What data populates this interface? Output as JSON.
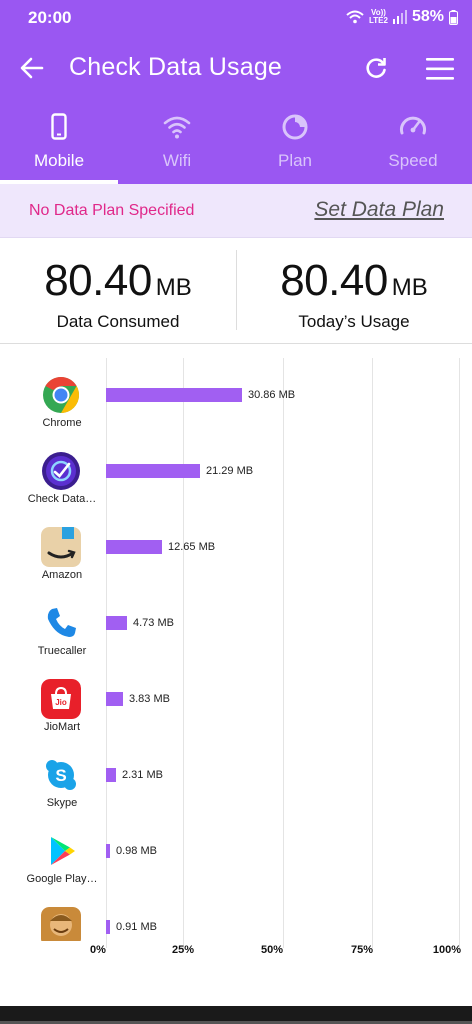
{
  "status": {
    "time": "20:00",
    "net_line1": "Vo))",
    "net_line2": "LTE2",
    "battery": "58%"
  },
  "header": {
    "title": "Check Data Usage"
  },
  "tabs": [
    {
      "label": "Mobile",
      "icon": "phone-icon",
      "active": true
    },
    {
      "label": "Wifi",
      "icon": "wifi-icon",
      "active": false
    },
    {
      "label": "Plan",
      "icon": "plan-icon",
      "active": false
    },
    {
      "label": "Speed",
      "icon": "speedometer-icon",
      "active": false
    }
  ],
  "plan": {
    "status": "No Data Plan Specified",
    "action": "Set Data Plan"
  },
  "totals": {
    "consumed_value": "80.40",
    "consumed_unit": "MB",
    "consumed_label": "Data Consumed",
    "today_value": "80.40",
    "today_unit": "MB",
    "today_label": "Today’s Usage"
  },
  "chart_data": {
    "type": "bar",
    "orientation": "horizontal",
    "categories": [
      "Chrome",
      "Check Data…",
      "Amazon",
      "Truecaller",
      "JioMart",
      "Skype",
      "Google Play…",
      ""
    ],
    "values_mb": [
      30.86,
      21.29,
      12.65,
      4.73,
      3.83,
      2.31,
      0.98,
      0.91
    ],
    "value_labels": [
      "30.86 MB",
      "21.29 MB",
      "12.65 MB",
      "4.73 MB",
      "3.83 MB",
      "2.31 MB",
      "0.98 MB",
      "0.91 MB"
    ],
    "x_ticks": [
      "0%",
      "25%",
      "50%",
      "75%",
      "100%"
    ],
    "xlim_percent": [
      0,
      100
    ],
    "total_mb": 80.4,
    "grid": true
  },
  "colors": {
    "primary": "#9a57f2",
    "bar": "#a15ff2",
    "plan_warning": "#e0288a",
    "plan_background": "#efe7fc"
  }
}
